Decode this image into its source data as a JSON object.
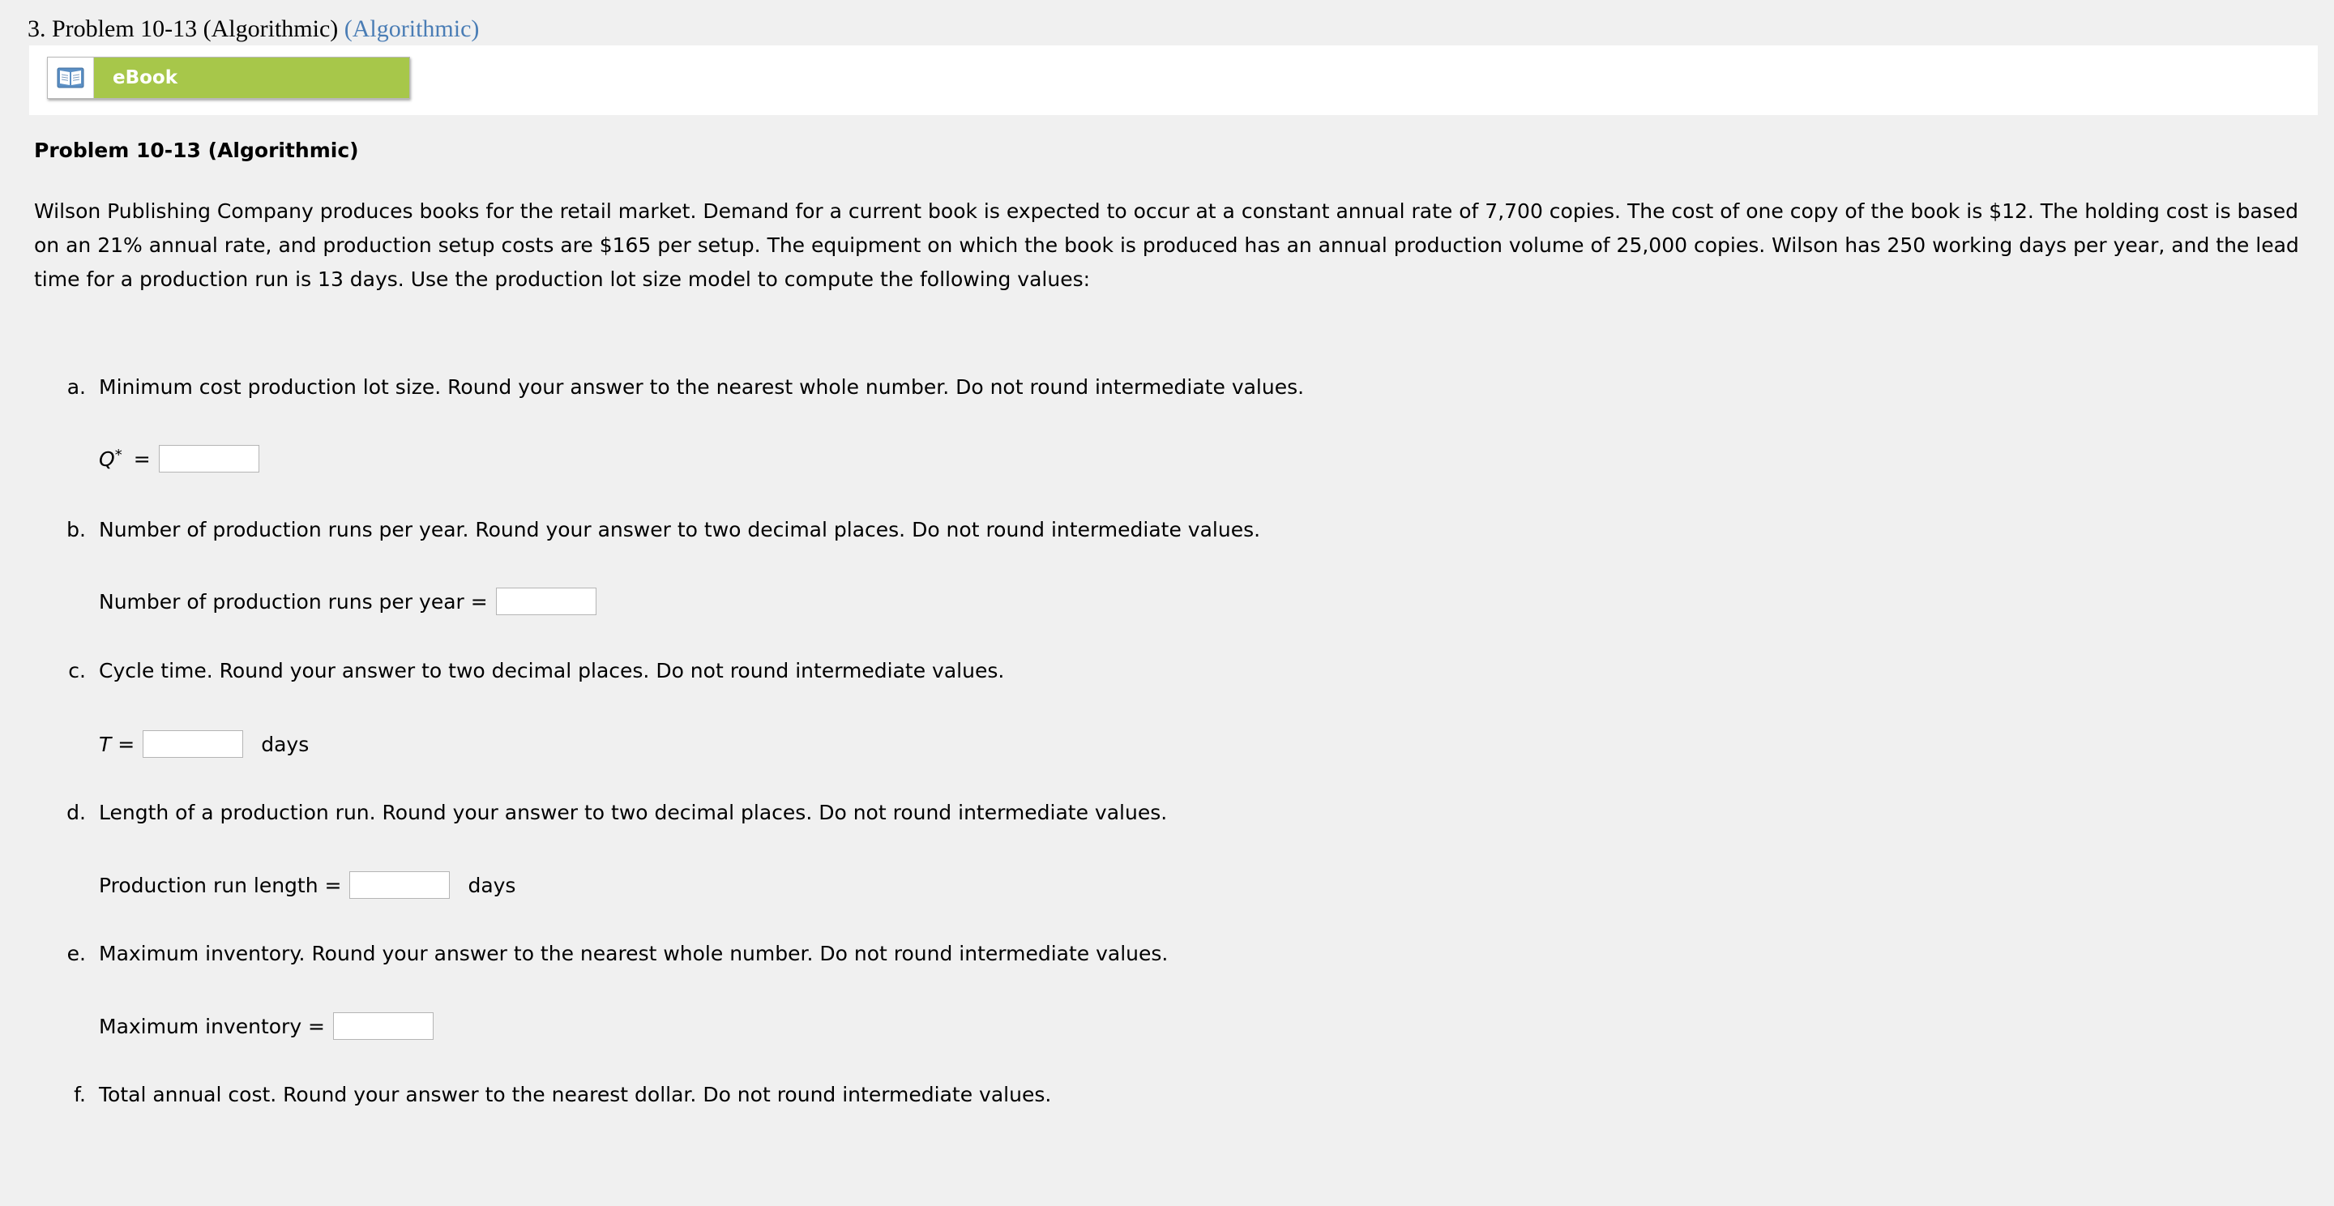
{
  "header": {
    "number_title": "3. Problem 10-13 (Algorithmic)",
    "algo_link": "(Algorithmic)"
  },
  "ebook": {
    "label": "eBook",
    "icon": "book-icon"
  },
  "problem": {
    "title": "Problem 10-13 (Algorithmic)",
    "text": "Wilson Publishing Company produces books for the retail market. Demand for a current book is expected to occur at a constant annual rate of 7,700 copies. The cost of one copy of the book is $12. The holding cost is based on an 21% annual rate, and production setup costs are $165 per setup. The equipment on which the book is produced has an annual production volume of 25,000 copies. Wilson has 250 working days per year, and the lead time for a production run is 13 days. Use the production lot size model to compute the following values:"
  },
  "parts": [
    {
      "letter": "a.",
      "text": "Minimum cost production lot size. Round your answer to the nearest whole number. Do not round intermediate values.",
      "label_main": "Q",
      "label_sup": "*",
      "label_suffix": "=",
      "value": "",
      "unit": ""
    },
    {
      "letter": "b.",
      "text": "Number of production runs per year. Round your answer to two decimal places. Do not round intermediate values.",
      "label": "Number of production runs per year =",
      "value": "",
      "unit": ""
    },
    {
      "letter": "c.",
      "text": "Cycle time. Round your answer to two decimal places. Do not round intermediate values.",
      "label_main": "T",
      "label_suffix": "=",
      "value": "",
      "unit": "days"
    },
    {
      "letter": "d.",
      "text": "Length of a production run. Round your answer to two decimal places. Do not round intermediate values.",
      "label": "Production run length =",
      "value": "",
      "unit": "days"
    },
    {
      "letter": "e.",
      "text": "Maximum inventory. Round your answer to the nearest whole number. Do not round intermediate values.",
      "label": "Maximum inventory =",
      "value": "",
      "unit": ""
    },
    {
      "letter": "f.",
      "text": "Total annual cost. Round your answer to the nearest dollar. Do not round intermediate values."
    }
  ],
  "colors": {
    "page_bg": "#f0f0f0",
    "ebook_green": "#a7c74a",
    "link_blue": "#4a7db5"
  }
}
